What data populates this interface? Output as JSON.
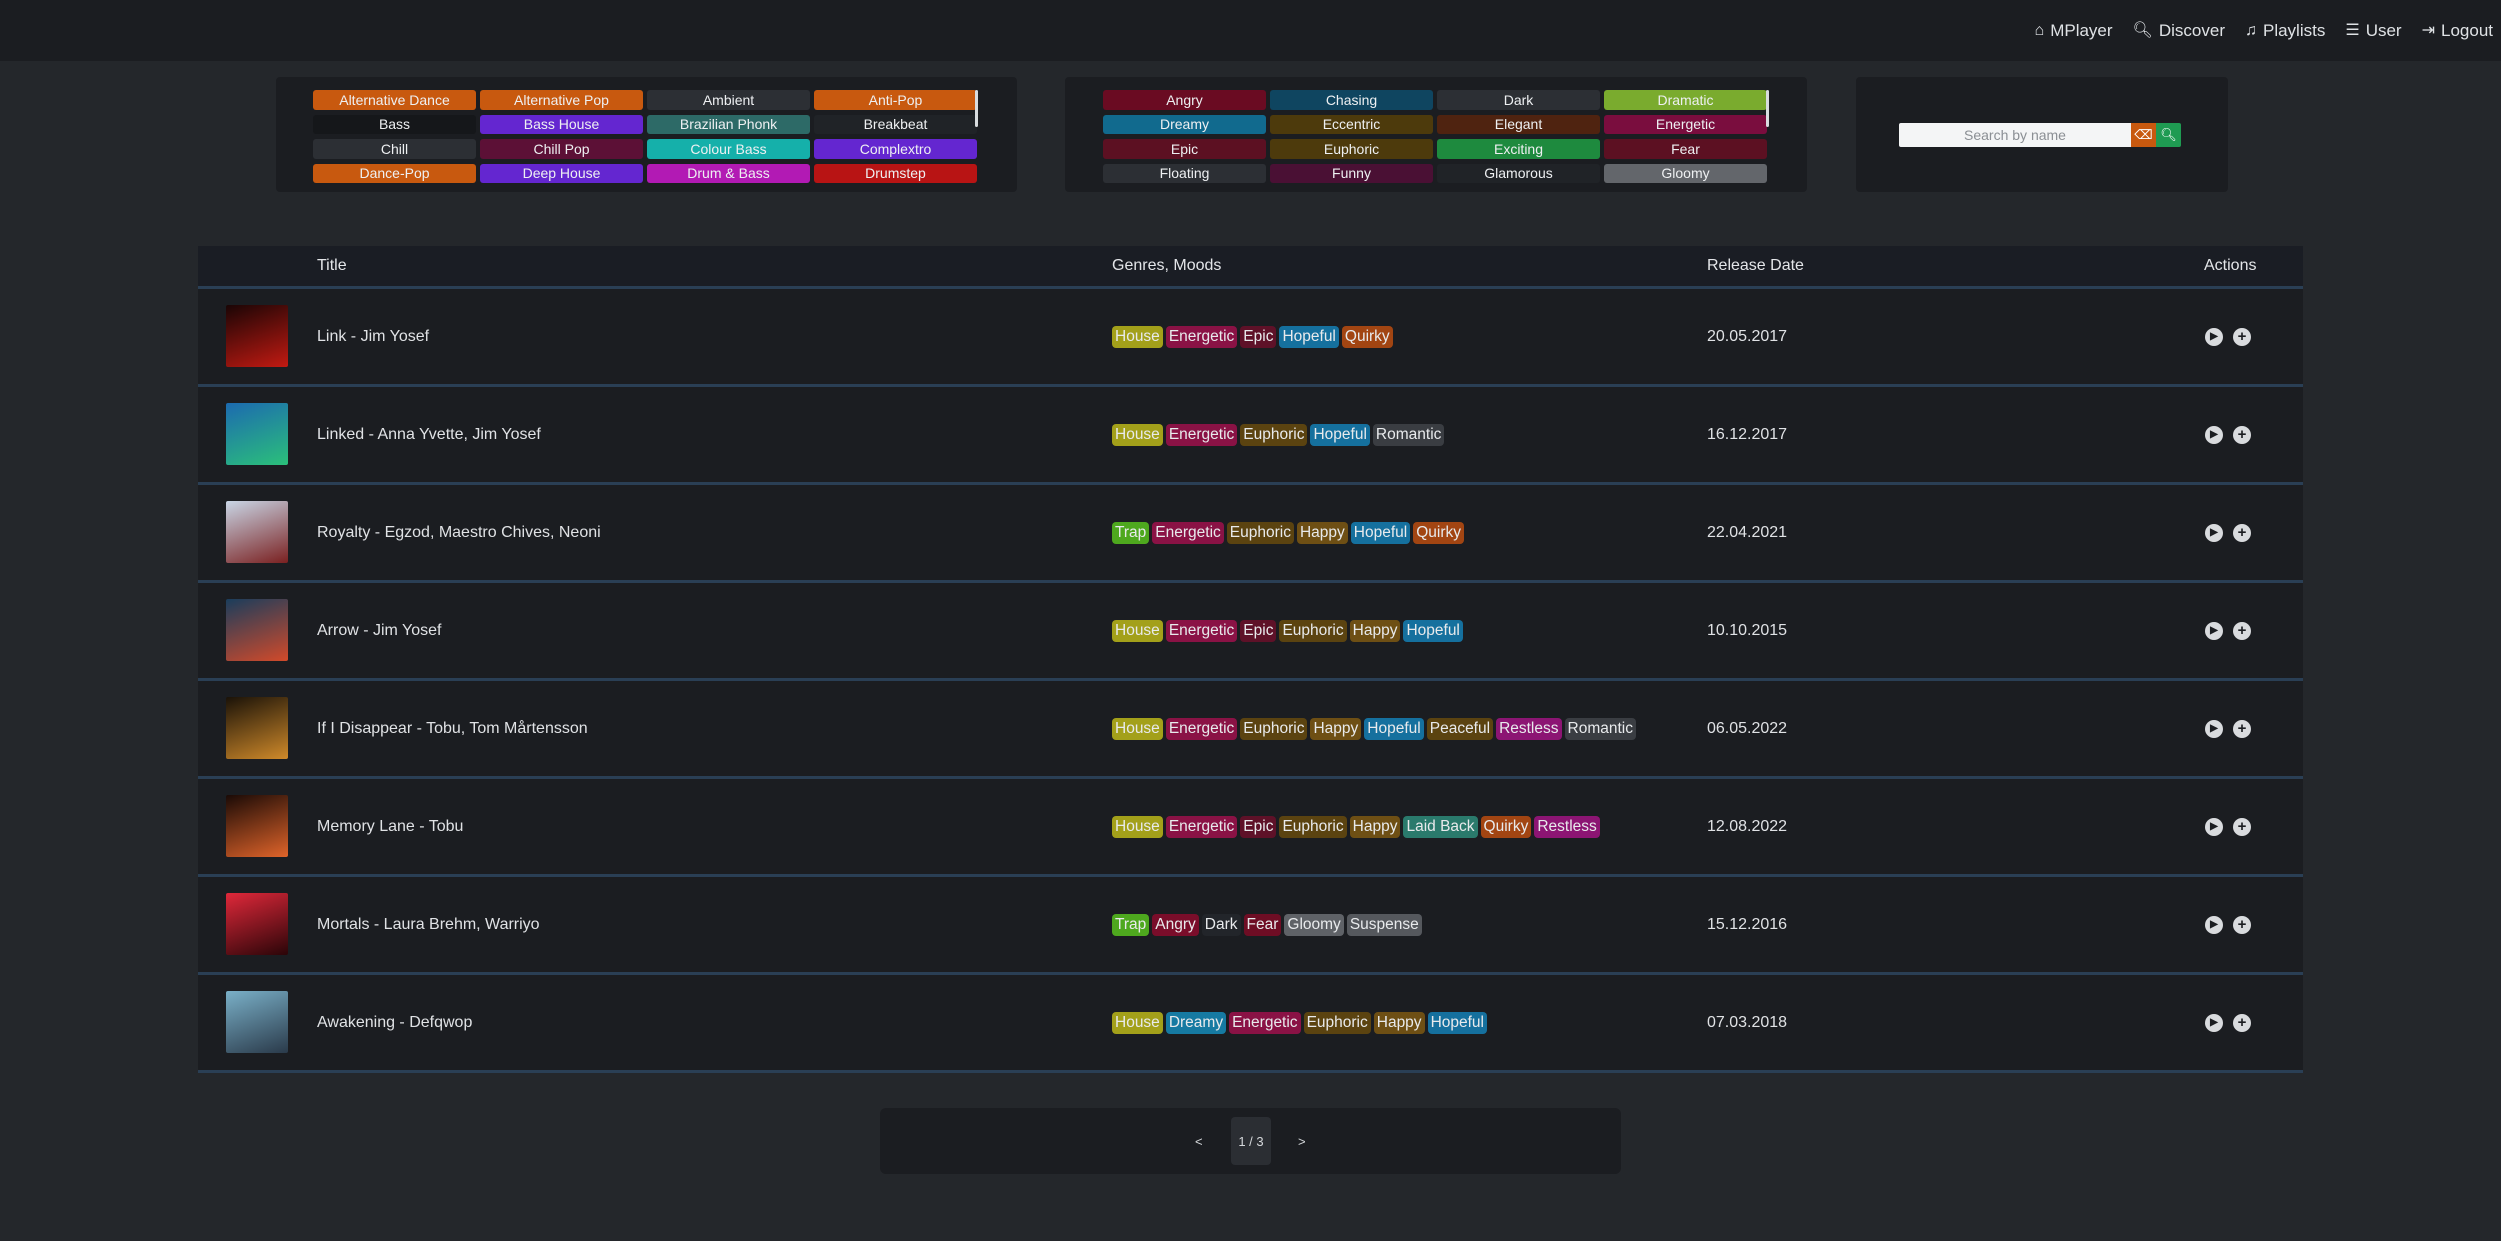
{
  "nav": {
    "brand": "MPlayer",
    "discover": "Discover",
    "playlists": "Playlists",
    "user": "User",
    "logout": "Logout"
  },
  "genres": [
    {
      "label": "Alternative Dance",
      "color": "#c8590f"
    },
    {
      "label": "Alternative Pop",
      "color": "#c8590f"
    },
    {
      "label": "Ambient",
      "color": "#2c2f34"
    },
    {
      "label": "Anti-Pop",
      "color": "#c8590f"
    },
    {
      "label": "Bass",
      "color": "#15171a"
    },
    {
      "label": "Bass House",
      "color": "#6426d0"
    },
    {
      "label": "Brazilian Phonk",
      "color": "#2d6a67"
    },
    {
      "label": "Breakbeat",
      "color": "#202327"
    },
    {
      "label": "Chill",
      "color": "#2c2f34"
    },
    {
      "label": "Chill Pop",
      "color": "#5c1036"
    },
    {
      "label": "Colour Bass",
      "color": "#15b0aa"
    },
    {
      "label": "Complextro",
      "color": "#6426d0"
    },
    {
      "label": "Dance-Pop",
      "color": "#c8590f"
    },
    {
      "label": "Deep House",
      "color": "#6426d0"
    },
    {
      "label": "Drum & Bass",
      "color": "#b21ab4"
    },
    {
      "label": "Drumstep",
      "color": "#b81414"
    }
  ],
  "moods": [
    {
      "label": "Angry",
      "color": "#6a0b22"
    },
    {
      "label": "Chasing",
      "color": "#0f4560"
    },
    {
      "label": "Dark",
      "color": "#2c2f34"
    },
    {
      "label": "Dramatic",
      "color": "#7aab2e"
    },
    {
      "label": "Dreamy",
      "color": "#116a8e"
    },
    {
      "label": "Eccentric",
      "color": "#4d3a0c"
    },
    {
      "label": "Elegant",
      "color": "#4f2310"
    },
    {
      "label": "Energetic",
      "color": "#7a0d3e"
    },
    {
      "label": "Epic",
      "color": "#5c1022"
    },
    {
      "label": "Euphoric",
      "color": "#4d3a0c"
    },
    {
      "label": "Exciting",
      "color": "#1e8a3e"
    },
    {
      "label": "Fear",
      "color": "#5c1022"
    },
    {
      "label": "Floating",
      "color": "#2c2f34"
    },
    {
      "label": "Funny",
      "color": "#4a1034"
    },
    {
      "label": "Glamorous",
      "color": "#202327"
    },
    {
      "label": "Gloomy",
      "color": "#63666b"
    }
  ],
  "search": {
    "placeholder": "Search by name"
  },
  "table": {
    "headers": {
      "title": "Title",
      "tags": "Genres, Moods",
      "date": "Release Date",
      "actions": "Actions"
    }
  },
  "tag_colors": {
    "House": "#a3a01a",
    "Trap": "#4ea81e",
    "Energetic": "#8a1245",
    "Epic": "#5e1128",
    "Hopeful": "#15709e",
    "Quirky": "#a24512",
    "Euphoric": "#5b4310",
    "Romantic": "#3a3d42",
    "Happy": "#6e4f14",
    "Peaceful": "#5b4310",
    "Restless": "#8c1573",
    "Laid Back": "#2a7a6c",
    "Angry": "#7a0d2a",
    "Dark": "#22252a",
    "Fear": "#6e0d24",
    "Gloomy": "#5f6267",
    "Suspense": "#55585d",
    "Dreamy": "#167aa2"
  },
  "tracks": [
    {
      "title": "Link - Jim Yosef",
      "date": "20.05.2017",
      "tags": [
        "House",
        "Energetic",
        "Epic",
        "Hopeful",
        "Quirky"
      ],
      "cover": [
        "#1a0505",
        "#c21a12"
      ]
    },
    {
      "title": "Linked - Anna Yvette, Jim Yosef",
      "date": "16.12.2017",
      "tags": [
        "House",
        "Energetic",
        "Euphoric",
        "Hopeful",
        "Romantic"
      ],
      "cover": [
        "#1c6ab0",
        "#2bc07a"
      ]
    },
    {
      "title": "Royalty - Egzod, Maestro Chives, Neoni",
      "date": "22.04.2021",
      "tags": [
        "Trap",
        "Energetic",
        "Euphoric",
        "Happy",
        "Hopeful",
        "Quirky"
      ],
      "cover": [
        "#c9d6e6",
        "#7a2020"
      ]
    },
    {
      "title": "Arrow - Jim Yosef",
      "date": "10.10.2015",
      "tags": [
        "House",
        "Energetic",
        "Epic",
        "Euphoric",
        "Happy",
        "Hopeful"
      ],
      "cover": [
        "#1a3d5c",
        "#d24a2a"
      ]
    },
    {
      "title": "If I Disappear - Tobu, Tom Mårtensson",
      "date": "06.05.2022",
      "tags": [
        "House",
        "Energetic",
        "Euphoric",
        "Happy",
        "Hopeful",
        "Peaceful",
        "Restless",
        "Romantic"
      ],
      "cover": [
        "#1a1208",
        "#d08a2a"
      ]
    },
    {
      "title": "Memory Lane - Tobu",
      "date": "12.08.2022",
      "tags": [
        "House",
        "Energetic",
        "Epic",
        "Euphoric",
        "Happy",
        "Laid Back",
        "Quirky",
        "Restless"
      ],
      "cover": [
        "#1a0a06",
        "#e0642a"
      ]
    },
    {
      "title": "Mortals - Laura Brehm, Warriyo",
      "date": "15.12.2016",
      "tags": [
        "Trap",
        "Angry",
        "Dark",
        "Fear",
        "Gloomy",
        "Suspense"
      ],
      "cover": [
        "#e0283a",
        "#2a0508"
      ]
    },
    {
      "title": "Awakening - Defqwop",
      "date": "07.03.2018",
      "tags": [
        "House",
        "Dreamy",
        "Energetic",
        "Euphoric",
        "Happy",
        "Hopeful"
      ],
      "cover": [
        "#7ab0c8",
        "#2a3a4a"
      ]
    }
  ],
  "pagination": {
    "prev": "<",
    "current": "1 / 3",
    "next": ">"
  }
}
